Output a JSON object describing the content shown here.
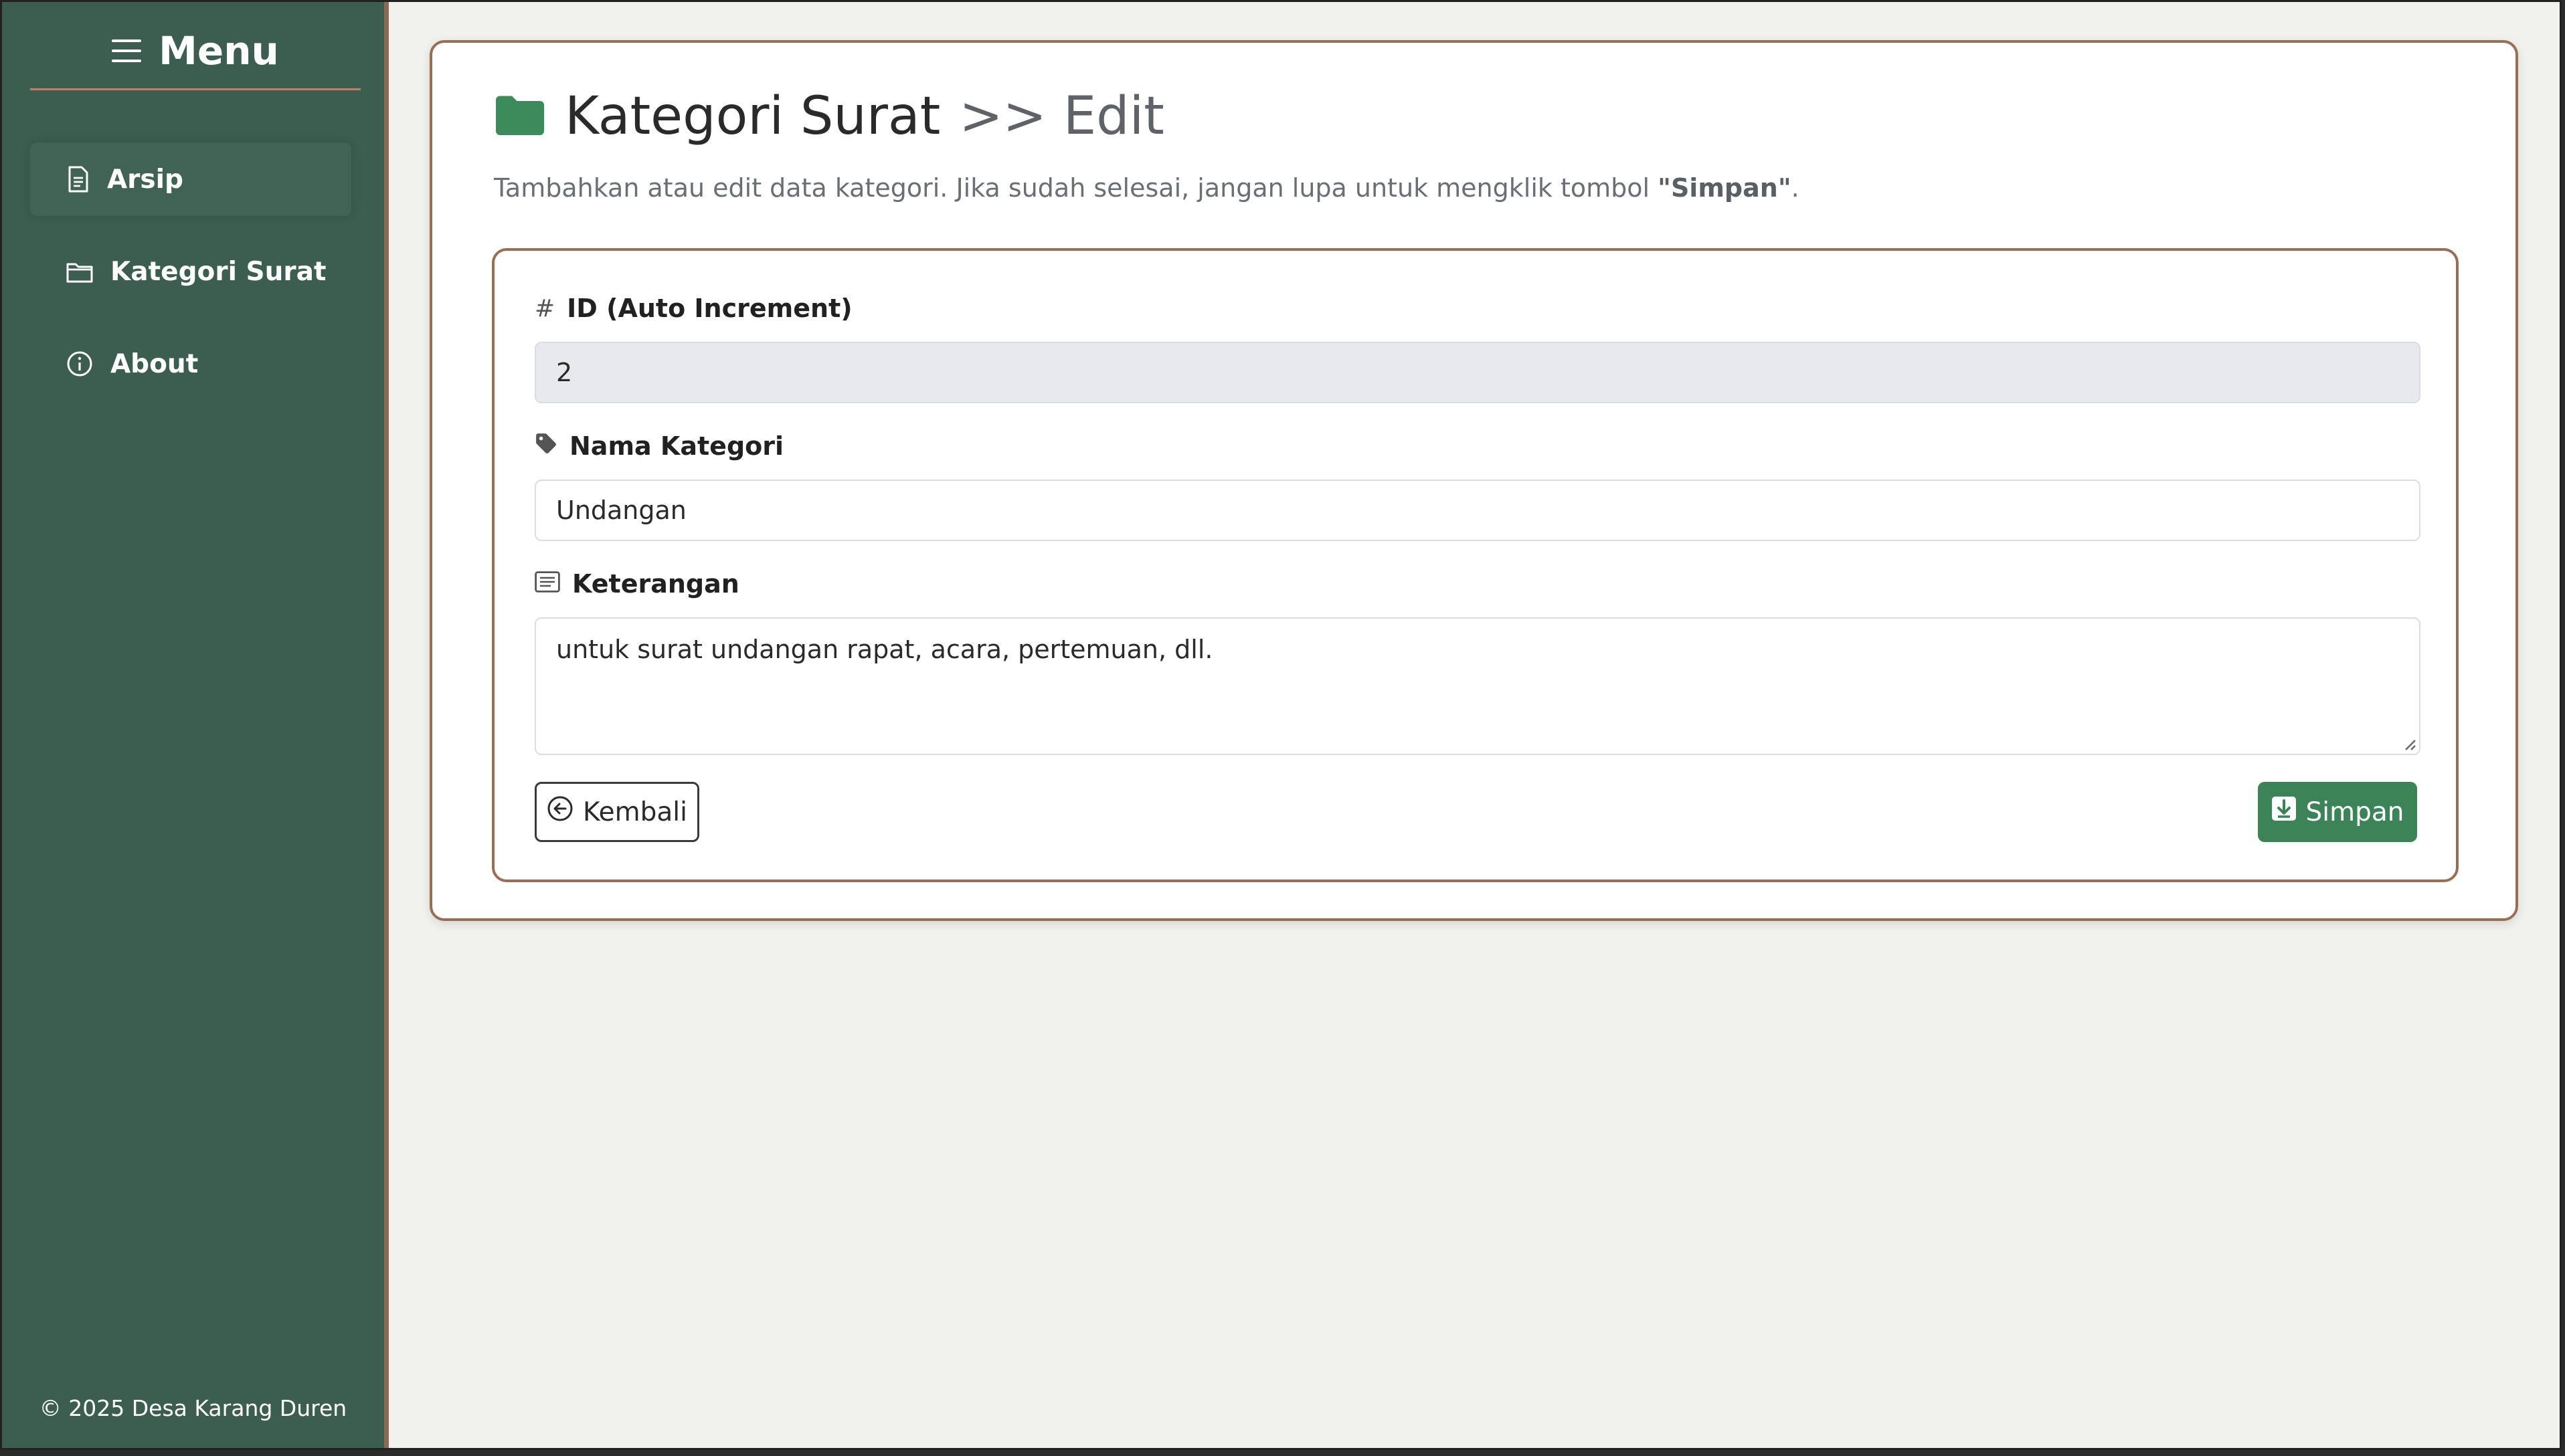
{
  "sidebar": {
    "menu_label": "Menu",
    "items": [
      {
        "label": "Arsip",
        "icon": "file-text-icon"
      },
      {
        "label": "Kategori Surat",
        "icon": "folder-outline-icon"
      },
      {
        "label": "About",
        "icon": "info-circle-icon"
      }
    ],
    "footer": "© 2025 Desa Karang Duren"
  },
  "page": {
    "title": "Kategori Surat",
    "crumb": ">> Edit",
    "subtitle_before": "Tambahkan atau edit data kategori. Jika sudah selesai, jangan lupa untuk mengklik tombol ",
    "subtitle_bold": "\"Simpan\"",
    "subtitle_after": "."
  },
  "form": {
    "id_label": "ID (Auto Increment)",
    "id_value": "2",
    "name_label": "Nama Kategori",
    "name_value": "Undangan",
    "desc_label": "Keterangan",
    "desc_value": "untuk surat undangan rapat, acara, pertemuan, dll.",
    "back_label": "Kembali",
    "save_label": "Simpan"
  },
  "colors": {
    "sidebar_bg": "#3b5e51",
    "accent_border": "#9a6e55",
    "save_button": "#3b8458",
    "folder_icon": "#3d8a5a"
  }
}
